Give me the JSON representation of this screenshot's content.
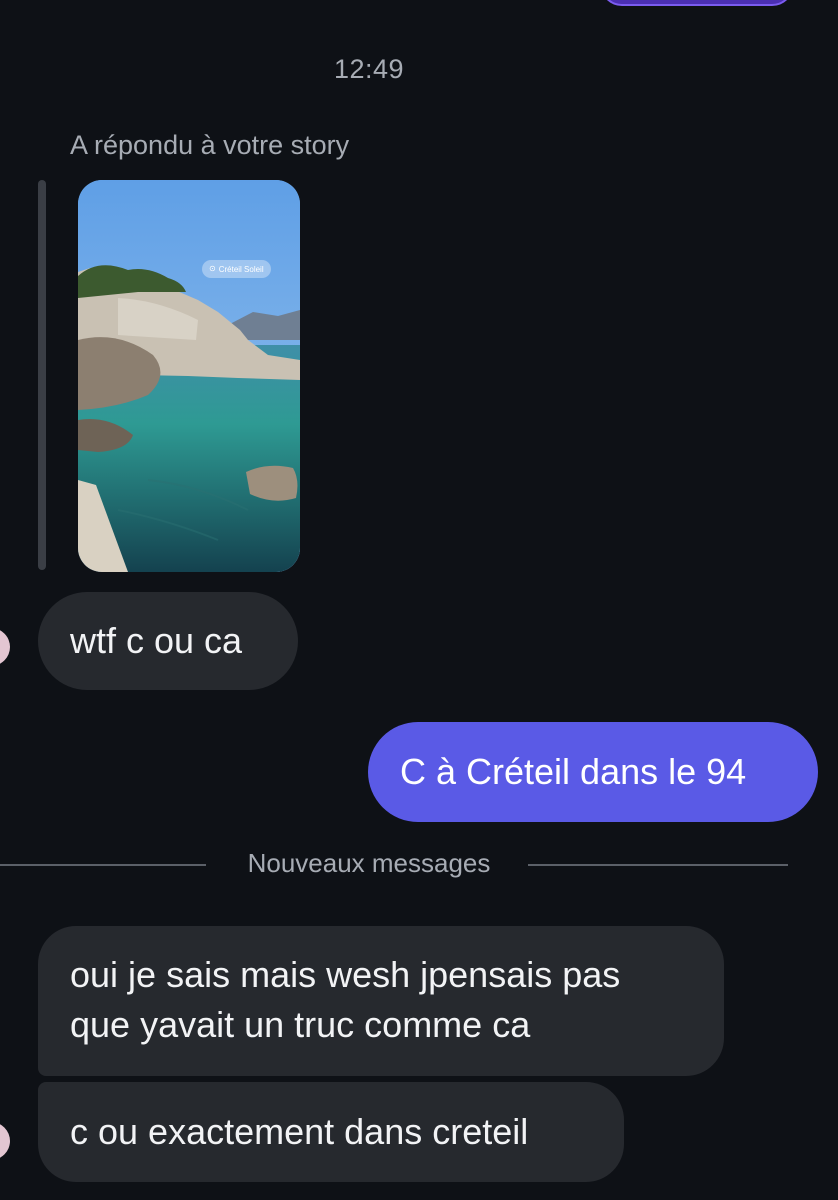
{
  "chat": {
    "timestamp": "12:49",
    "reply_label": "A répondu à votre story",
    "story": {
      "location_tag": "Créteil Soleil",
      "location_icon": "location-pin-icon"
    },
    "messages": [
      {
        "sender": "them",
        "text": "wtf c ou ca"
      },
      {
        "sender": "me",
        "text": "C à Créteil dans le 94"
      },
      {
        "sender": "them",
        "text": "oui je sais mais wesh jpensais pas"
      },
      {
        "sender": "them",
        "text": "que yavait un truc comme ca"
      },
      {
        "sender": "them",
        "text": "c ou exactement dans creteil"
      }
    ],
    "new_messages_divider": "Nouveaux messages"
  },
  "colors": {
    "background": "#0e1116",
    "incoming_bubble": "#26292e",
    "outgoing_bubble": "#5a5ae6",
    "secondary_text": "#a7acb4",
    "avatar": "#e3c6d2"
  }
}
